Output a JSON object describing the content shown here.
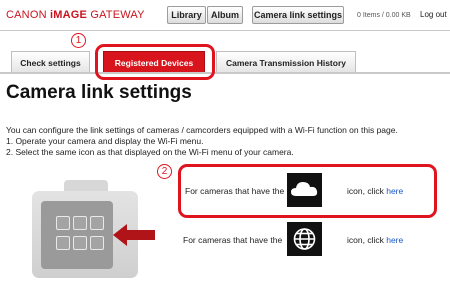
{
  "header": {
    "logo_brand": "CANON",
    "logo_image": "iMAGE",
    "logo_gateway": "GATEWAY",
    "library_label": "Library",
    "album_label": "Album",
    "camera_link_settings_label": "Camera link settings",
    "storage": "0 Items / 0.00 KB",
    "logout_label": "Log out"
  },
  "tabs": [
    {
      "label": "Check settings"
    },
    {
      "label": "Registered Devices"
    },
    {
      "label": "Camera Transmission History"
    }
  ],
  "markers": {
    "one": "1",
    "two": "2"
  },
  "page_title": "Camera link settings",
  "intro": {
    "line1": "You can configure the link settings of cameras / camcorders equipped with a Wi-Fi function on this page.",
    "line2": "1. Operate your camera and display the Wi-Fi menu.",
    "line3": "2. Select the same icon as that displayed on the Wi-Fi menu of your camera."
  },
  "rows": [
    {
      "prefix": "For cameras that have the",
      "icon": "cloud-icon",
      "suffix": "icon, click",
      "link": "here"
    },
    {
      "prefix": "For cameras that have the",
      "icon": "globe-icon",
      "suffix": "icon, click",
      "link": "here"
    }
  ],
  "colors": {
    "accent": "#d8151d",
    "highlight": "#e0141e",
    "link": "#1a55c8"
  }
}
